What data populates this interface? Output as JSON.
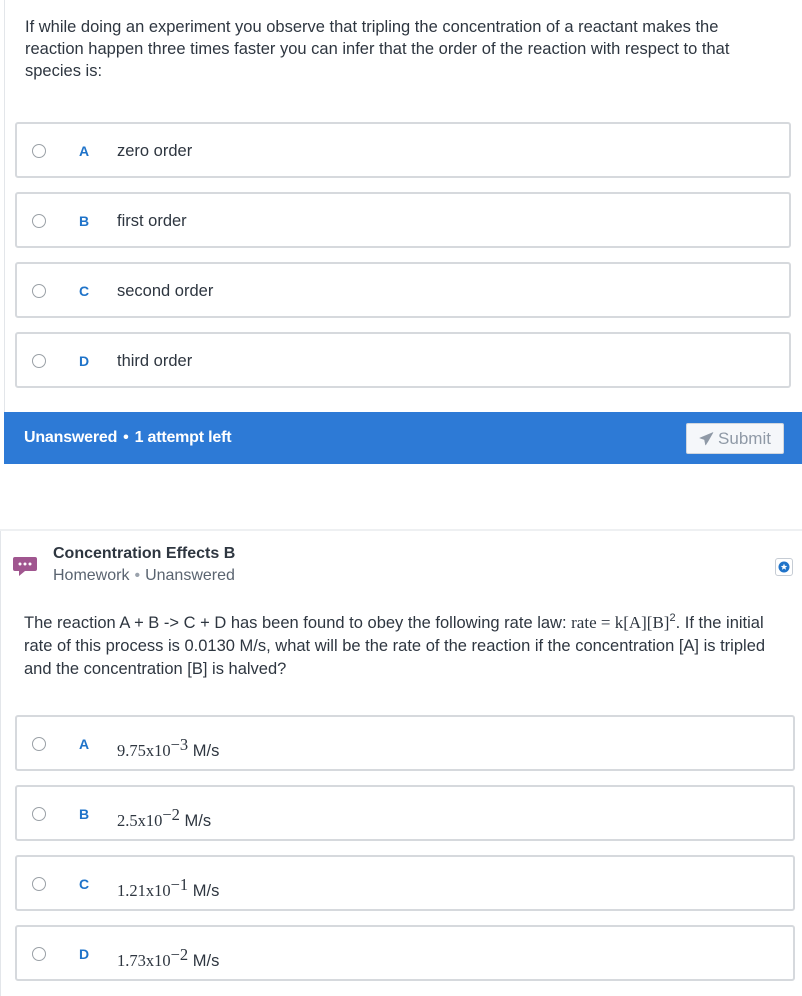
{
  "question1": {
    "text": "If while doing an experiment you observe that tripling the concentration of a reactant makes the reaction happen three times faster you can infer that the order of the reaction with respect to that species is:",
    "options": [
      {
        "letter": "A",
        "text": "zero order"
      },
      {
        "letter": "B",
        "text": "first order"
      },
      {
        "letter": "C",
        "text": "second order"
      },
      {
        "letter": "D",
        "text": "third order"
      }
    ],
    "status": {
      "state": "Unanswered",
      "attempts": "1 attempt left",
      "separator": "•"
    },
    "submit_label": "Submit"
  },
  "question2": {
    "title": "Concentration Effects B",
    "category": "Homework",
    "status": "Unanswered",
    "text_before": "The reaction A + B -> C + D has been found to obey the following rate law: ",
    "rate_law": "rate = k[A][B]",
    "rate_law_exp": "2",
    "text_after": ". If the initial rate of this process is 0.0130 M/s, what will be the rate of the reaction if the concentration [A] is tripled and the concentration [B] is halved?",
    "options": [
      {
        "letter": "A",
        "mantissa": "9.75x10",
        "exponent": "−3",
        "unit": " M/s"
      },
      {
        "letter": "B",
        "mantissa": "2.5x10",
        "exponent": "−2",
        "unit": " M/s"
      },
      {
        "letter": "C",
        "mantissa": "1.21x10",
        "exponent": "−1",
        "unit": " M/s"
      },
      {
        "letter": "D",
        "mantissa": "1.73x10",
        "exponent": "−2",
        "unit": " M/s"
      }
    ]
  },
  "colors": {
    "accent": "#2d7ad6",
    "letter": "#1f73c9",
    "chat_icon": "#a0568f"
  }
}
